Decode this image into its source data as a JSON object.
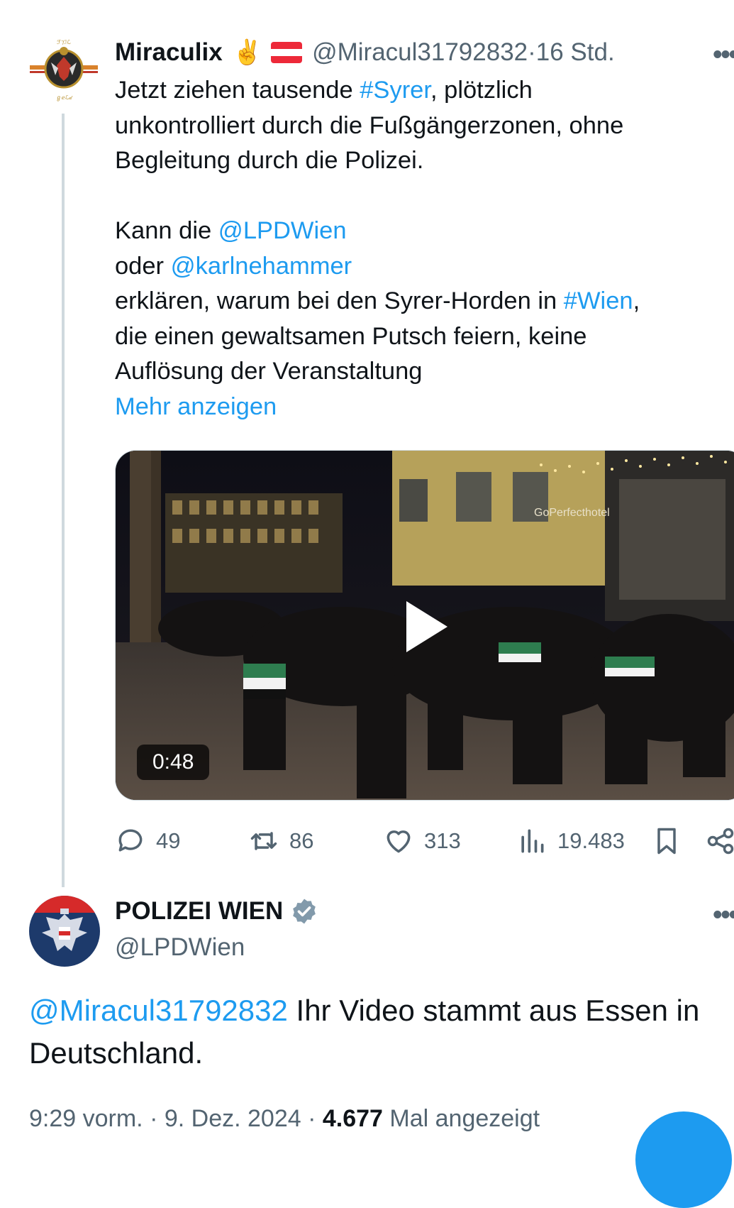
{
  "tweet1": {
    "author_name": "Miraculix",
    "author_emoji": "✌️",
    "flag_colors": [
      "#ed2939",
      "#ffffff",
      "#ed2939"
    ],
    "handle": "@Miracul31792832",
    "separator": " · ",
    "time": "16 Std.",
    "lines": [
      {
        "before": "Jetzt ziehen tausende ",
        "link": "#Syrer",
        "after": ", plötzlich"
      },
      {
        "text": "unkontrolliert durch die Fußgängerzonen, ohne"
      },
      {
        "text": "Begleitung durch die Polizei."
      },
      {
        "text": "Kann die ",
        "link": "@LPDWien"
      },
      {
        "text": "oder ",
        "link": "@karlnehammer"
      },
      {
        "before": "erklären,  warum bei den Syrer-Horden in ",
        "link": "#Wien",
        "after": ","
      },
      {
        "text": "die einen gewaltsamen Putsch  feiern, keine"
      },
      {
        "text": "Auflösung der Veranstaltung"
      }
    ],
    "show_more": "Mehr anzeigen",
    "video": {
      "duration": "0:48"
    },
    "actions": {
      "replies": "49",
      "reposts": "86",
      "likes": "313",
      "views": "19.483"
    }
  },
  "tweet2": {
    "author_name": "POLIZEI WIEN",
    "handle": "@LPDWien",
    "mention": "@Miracul31792832",
    "text_line1": " Ihr Video stammt aus Essen in",
    "text_line2": "Deutschland.",
    "time": "9:29 vorm.",
    "date": "9. Dez. 2024",
    "views_count": "4.677",
    "views_label": "Mal angezeigt"
  },
  "colors": {
    "link": "#1d9bf0",
    "muted": "#536471",
    "text": "#0f1419",
    "verified": "#829aab"
  }
}
